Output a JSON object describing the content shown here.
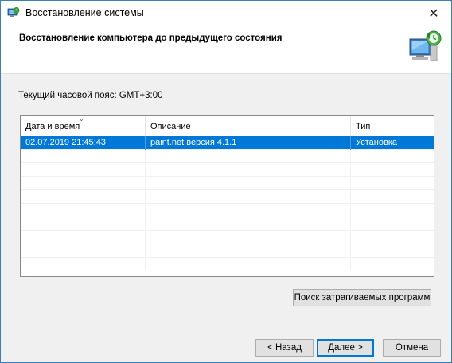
{
  "window": {
    "title": "Восстановление системы",
    "close_glyph": "✕"
  },
  "header": {
    "title": "Восстановление компьютера до предыдущего состояния"
  },
  "timezone_label": "Текущий часовой пояс: GMT+3:00",
  "table": {
    "columns": [
      "Дата и время",
      "Описание",
      "Тип"
    ],
    "sort_glyph": "⌄",
    "rows": [
      {
        "date": "02.07.2019 21:45:43",
        "description": "paint.net версия 4.1.1",
        "type": "Установка",
        "selected": true
      }
    ]
  },
  "buttons": {
    "scan": "Поиск затрагиваемых программ",
    "back": "< Назад",
    "next": "Далее >",
    "cancel": "Отмена"
  },
  "colors": {
    "selection": "#0078d7",
    "window_border": "#3c7fb1"
  },
  "icons": {
    "title": "system-restore-icon",
    "header": "computer-restore-icon"
  }
}
